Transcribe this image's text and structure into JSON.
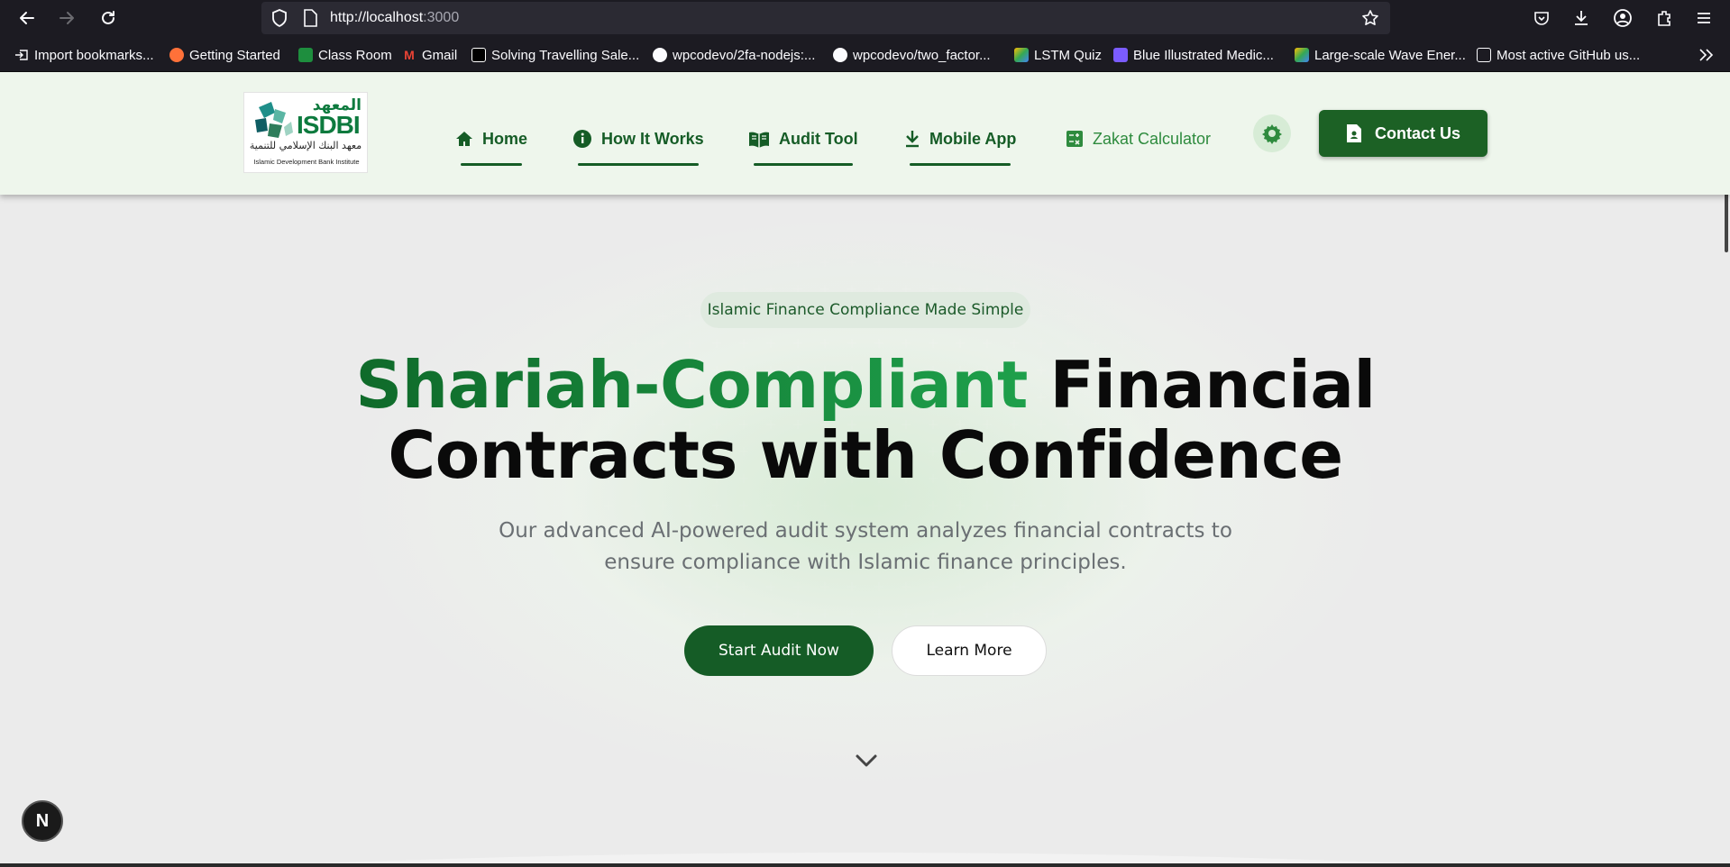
{
  "browser": {
    "url_host": "http://localhost",
    "url_port": ":3000",
    "bookmarks": [
      "Import bookmarks...",
      "Getting Started",
      "Class Room",
      "Gmail",
      "Solving Travelling Sale...",
      "wpcodevo/2fa-nodejs:...",
      "wpcodevo/two_factor...",
      "LSTM Quiz",
      "Blue Illustrated Medic...",
      "Large-scale Wave Ener...",
      "Most active GitHub us..."
    ]
  },
  "logo": {
    "arabic_title": "المعهد",
    "name": "ISDBI",
    "arabic_subtitle": "معهد البنك الإسلامي للتنمية",
    "english": "Islamic Development Bank Institute"
  },
  "nav": {
    "home": "Home",
    "how_it_works": "How It Works",
    "audit_tool": "Audit Tool",
    "mobile_app": "Mobile App",
    "zakat": "Zakat Calculator",
    "contact": "Contact Us"
  },
  "hero": {
    "pill": "Islamic Finance Compliance Made Simple",
    "title_green": "Shariah-Compliant",
    "title_rest_1": " Financial",
    "title_rest_2": "Contracts with Confidence",
    "subtitle_1": "Our advanced AI-powered audit system analyzes financial contracts to",
    "subtitle_2": "ensure compliance with Islamic finance principles.",
    "cta_primary": "Start Audit Now",
    "cta_secondary": "Learn More"
  },
  "badge": "N",
  "colors": {
    "brand_green": "#155c26",
    "accent_green": "#1ea04b",
    "header_bg": "#eef6ec"
  }
}
